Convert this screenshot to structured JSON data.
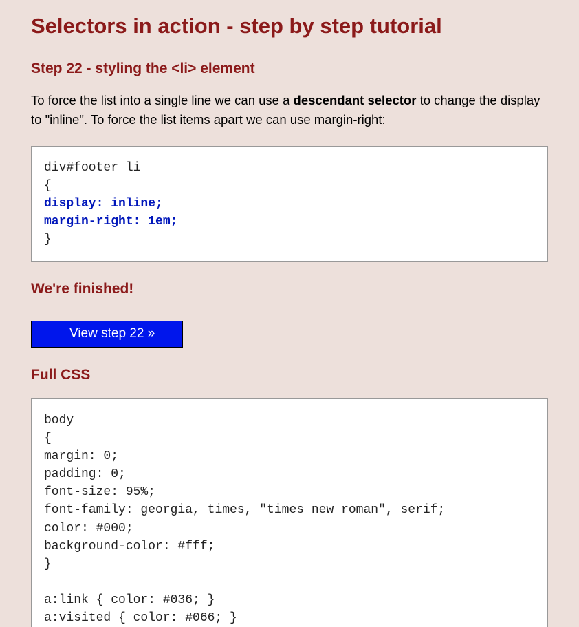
{
  "title": "Selectors in action - step by step tutorial",
  "step_heading": "Step 22 - styling the <li> element",
  "intro": {
    "part1": "To force the list into a single line we can use a ",
    "bold": "descendant selector",
    "part2": " to change the display to \"inline\". To force the list items apart we can use margin-right:"
  },
  "code1": {
    "line1": "div#footer li",
    "line2": "{",
    "hl1": "display: inline;",
    "hl2": "margin-right: 1em;",
    "line5": "}"
  },
  "finished_heading": "We're finished!",
  "button_label": "View step 22 »",
  "full_css_heading": "Full CSS",
  "code2": "body\n{\nmargin: 0;\npadding: 0;\nfont-size: 95%;\nfont-family: georgia, times, \"times new roman\", serif;\ncolor: #000;\nbackground-color: #fff;\n}\n\na:link { color: #036; }\na:visited { color: #066; }"
}
